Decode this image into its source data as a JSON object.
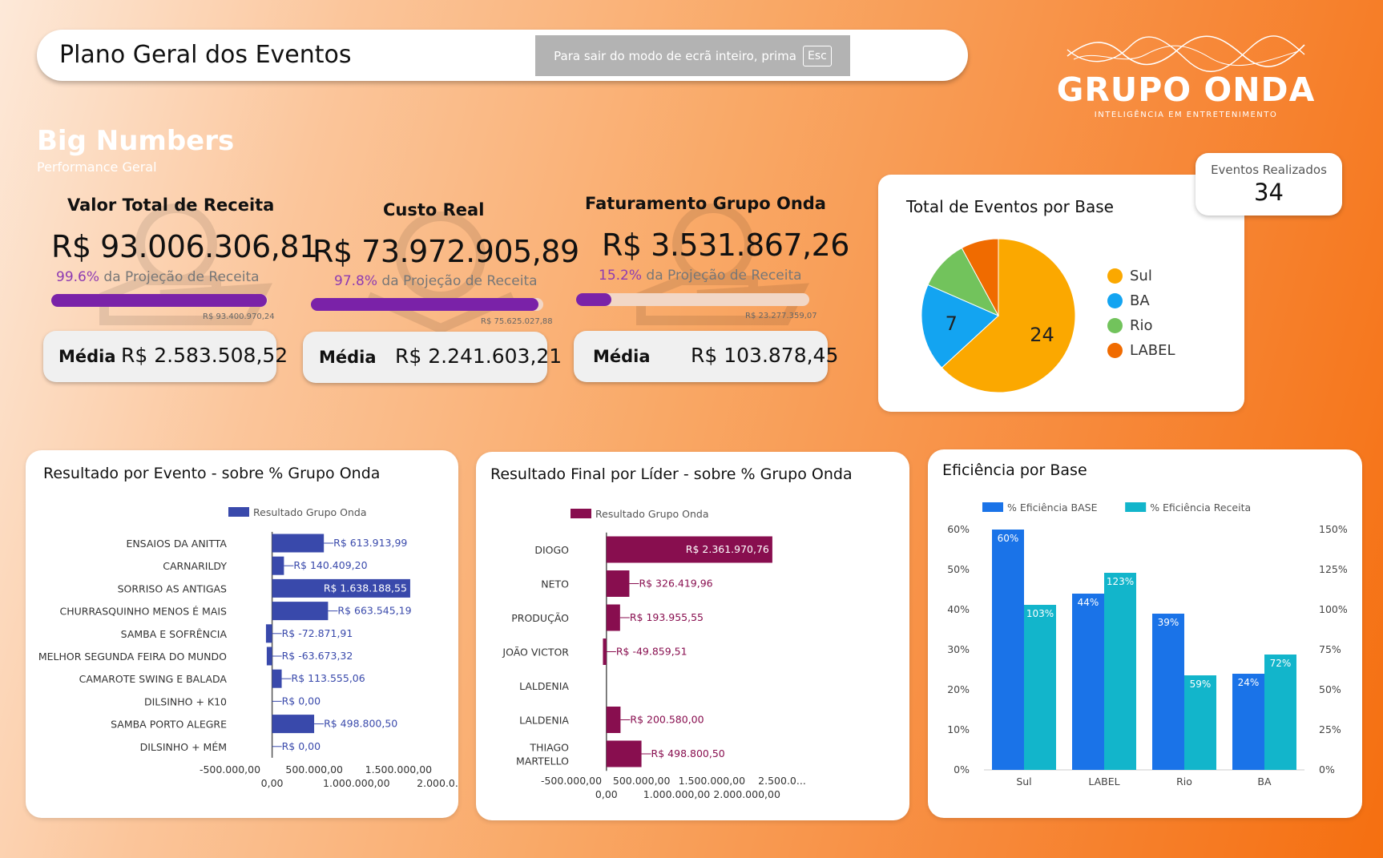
{
  "header": {
    "title": "Plano Geral dos Eventos"
  },
  "fullscreen_notice": {
    "text": "Para sair do modo de ecrã inteiro, prima",
    "key": "Esc"
  },
  "logo": {
    "title": "GRUPO ONDA",
    "subtitle": "INTELIGÊNCIA EM ENTRETENIMENTO"
  },
  "big_numbers": {
    "title": "Big Numbers",
    "subtitle": "Performance Geral",
    "kpis": [
      {
        "title": "Valor Total de Receita",
        "value": "R$ 93.006.306,81",
        "pct": "99.6%",
        "pct_label": "da Projeção de Receita",
        "progress": 0.996,
        "target": "R$ 93.400.970,24",
        "media_label": "Média",
        "media_value": "R$ 2.583.508,52"
      },
      {
        "title": "Custo Real",
        "value": "R$ 73.972.905,89",
        "pct": "97.8%",
        "pct_label": "da Projeção de Receita",
        "progress": 0.978,
        "target": "R$ 75.625.027,88",
        "media_label": "Média",
        "media_value": "R$ 2.241.603,21"
      },
      {
        "title": "Faturamento Grupo Onda",
        "value": "R$ 3.531.867,26",
        "pct": "15.2%",
        "pct_label": "da Projeção de Receita",
        "progress": 0.152,
        "target": "R$ 23.277.359,07",
        "media_label": "Média",
        "media_value": "R$ 103.878,45"
      }
    ]
  },
  "eventos_realizados": {
    "label": "Eventos Realizados",
    "value": "34"
  },
  "pie": {
    "title": "Total de Eventos por Base",
    "slices": [
      {
        "name": "Sul",
        "value": 24,
        "color": "#fba800",
        "label": "24"
      },
      {
        "name": "BA",
        "value": 7,
        "color": "#13a4f1",
        "label": "7"
      },
      {
        "name": "Rio",
        "value": 4,
        "color": "#72c35c",
        "label": ""
      },
      {
        "name": "LABEL",
        "value": 3,
        "color": "#f06b00",
        "label": ""
      }
    ]
  },
  "chart_data": [
    {
      "type": "bar",
      "orientation": "horizontal",
      "title": "Resultado por Evento - sobre % Grupo Onda",
      "legend": "Resultado Grupo Onda",
      "color": "#3949ab",
      "categories": [
        "ENSAIOS DA ANITTA",
        "CARNARILDY",
        "SORRISO AS ANTIGAS",
        "CHURRASQUINHO MENOS É MAIS",
        "SAMBA E SOFRÊNCIA",
        "MELHOR SEGUNDA FEIRA DO MUNDO",
        "CAMAROTE SWING E BALADA",
        "DILSINHO + K10",
        "SAMBA PORTO ALEGRE",
        "DILSINHO + MÉM"
      ],
      "values": [
        613913.99,
        140409.2,
        1638188.55,
        663545.19,
        -72871.91,
        -63673.32,
        113555.06,
        0,
        498800.5,
        0
      ],
      "value_labels": [
        "R$ 613.913,99",
        "R$ 140.409,20",
        "R$ 1.638.188,55",
        "R$ 663.545,19",
        "R$ -72.871,91",
        "R$ -63.673,32",
        "R$ 113.555,06",
        "R$ 0,00",
        "R$ 498.800,50",
        "R$ 0,00"
      ],
      "inside_label_index": 2,
      "xlim": [
        -500000,
        2000000
      ],
      "ticks_top": [
        "-500.000,00",
        "500.000,00",
        "1.500.000,00"
      ],
      "ticks_bottom": [
        "0,00",
        "1.000.000,00",
        "2.000.0..."
      ]
    },
    {
      "type": "bar",
      "orientation": "horizontal",
      "title": "Resultado Final por Líder - sobre % Grupo Onda",
      "legend": "Resultado Grupo Onda",
      "color": "#880e4f",
      "categories": [
        "DIOGO",
        "NETO",
        "PRODUÇÃO",
        "JOÃO VICTOR",
        "LALDENIA",
        "LALDENIA",
        "THIAGO MARTELLO"
      ],
      "values": [
        2361970.76,
        326419.96,
        193955.55,
        -49859.51,
        null,
        200580.0,
        498800.5
      ],
      "value_labels": [
        "R$ 2.361.970,76",
        "R$ 326.419,96",
        "R$ 193.955,55",
        "R$ -49.859,51",
        "",
        "R$ 200.580,00",
        "R$ 498.800,50"
      ],
      "inside_label_index": 0,
      "xlim": [
        -500000,
        2500000
      ],
      "ticks_top": [
        "-500.000,00",
        "500.000,00",
        "1.500.000,00",
        "2.500.0..."
      ],
      "ticks_bottom": [
        "0,00",
        "1.000.000,00",
        "2.000.000,00"
      ]
    },
    {
      "type": "bar",
      "orientation": "vertical",
      "title": "Eficiência por Base",
      "categories": [
        "Sul",
        "LABEL",
        "Rio",
        "BA"
      ],
      "series": [
        {
          "name": "% Eficiência BASE",
          "values": [
            60,
            44,
            39,
            24
          ],
          "labels": [
            "60%",
            "44%",
            "39%",
            "24%"
          ],
          "color": "#1a73e8",
          "axis": "left"
        },
        {
          "name": "% Eficiência Receita",
          "values": [
            103,
            123,
            59,
            72
          ],
          "labels": [
            "103%",
            "123%",
            "59%",
            "72%"
          ],
          "color": "#12b5cb",
          "axis": "right"
        }
      ],
      "ylim_left": [
        0,
        60
      ],
      "ylim_right": [
        0,
        150
      ],
      "ticks_left": [
        "0%",
        "10%",
        "20%",
        "30%",
        "40%",
        "50%",
        "60%"
      ],
      "ticks_right": [
        "0%",
        "25%",
        "50%",
        "75%",
        "100%",
        "125%",
        "150%"
      ]
    }
  ]
}
